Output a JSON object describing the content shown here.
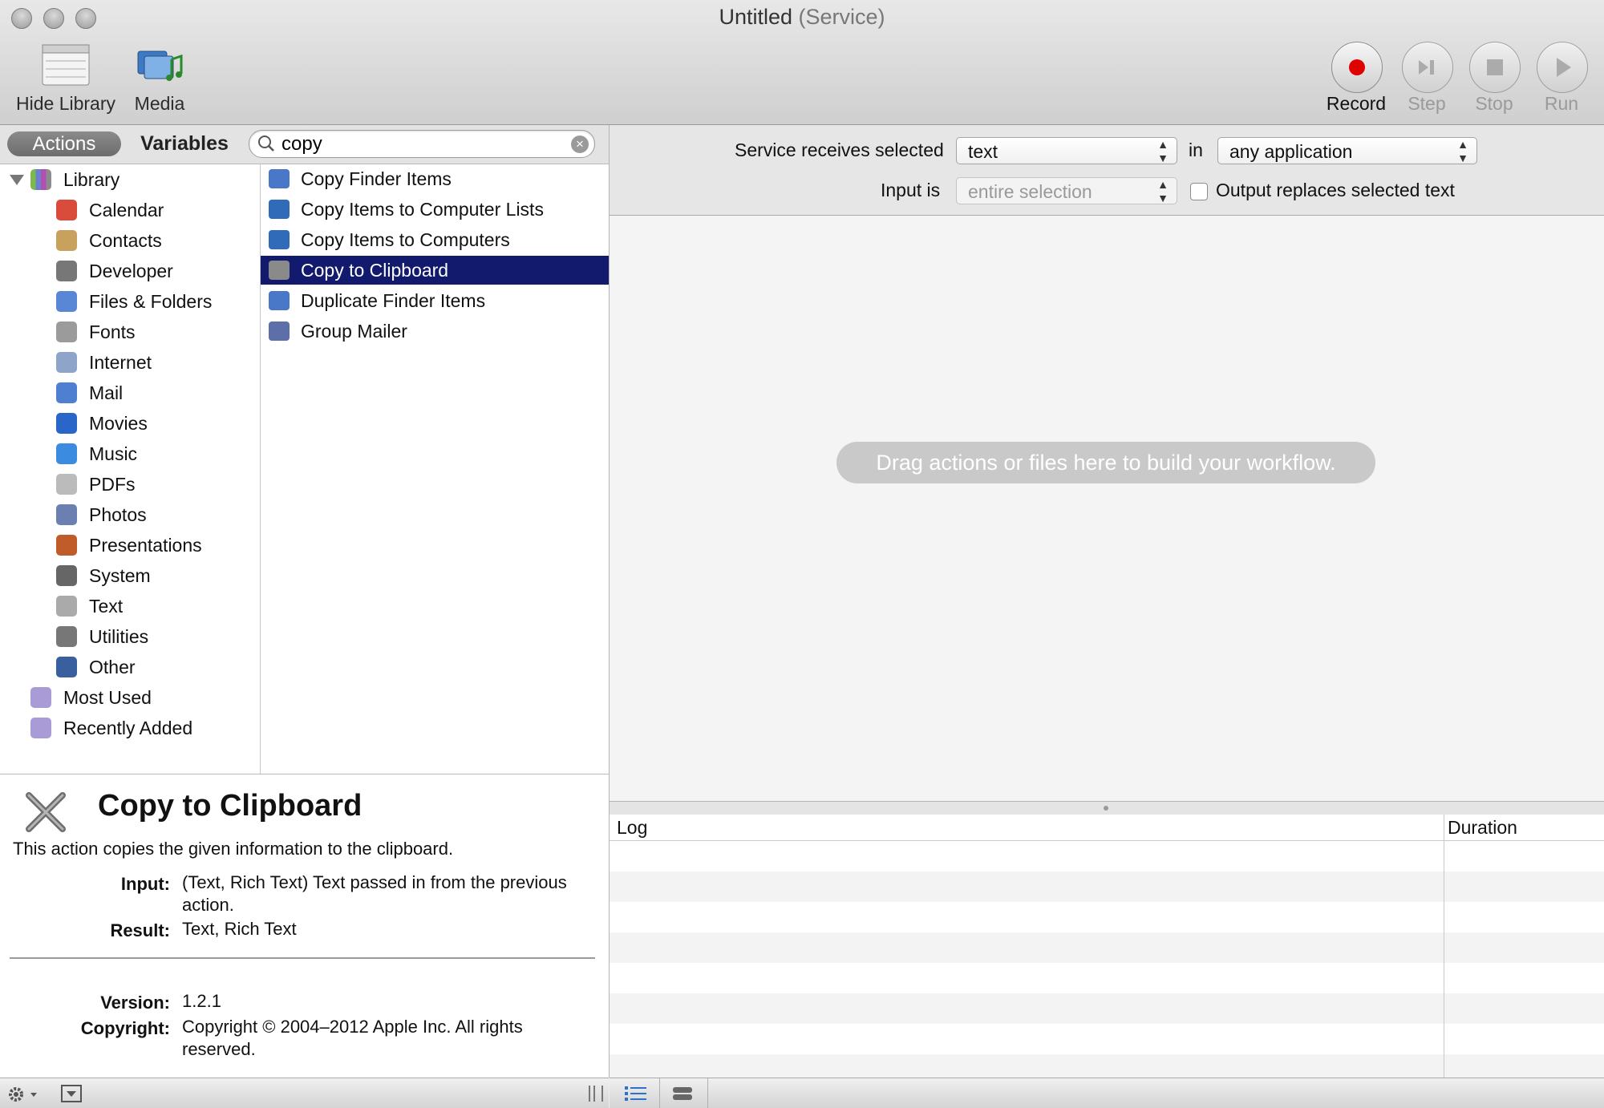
{
  "window": {
    "title": "Untitled",
    "subtitle": "(Service)"
  },
  "toolbar": {
    "hide_library": "Hide Library",
    "media": "Media",
    "record": "Record",
    "step": "Step",
    "stop": "Stop",
    "run": "Run"
  },
  "library_header": {
    "actions_tab": "Actions",
    "variables_tab": "Variables",
    "search_value": "copy"
  },
  "library": {
    "root": "Library",
    "items": [
      "Calendar",
      "Contacts",
      "Developer",
      "Files & Folders",
      "Fonts",
      "Internet",
      "Mail",
      "Movies",
      "Music",
      "PDFs",
      "Photos",
      "Presentations",
      "System",
      "Text",
      "Utilities",
      "Other"
    ],
    "smart": [
      "Most Used",
      "Recently Added"
    ]
  },
  "actions": {
    "items": [
      "Copy Finder Items",
      "Copy Items to Computer Lists",
      "Copy Items to Computers",
      "Copy to Clipboard",
      "Duplicate Finder Items",
      "Group Mailer"
    ],
    "selected": "Copy to Clipboard"
  },
  "description": {
    "title": "Copy to Clipboard",
    "summary": "This action copies the given information to the clipboard.",
    "input_label": "Input:",
    "input_value": "(Text, Rich Text) Text passed in from the previous action.",
    "result_label": "Result:",
    "result_value": "Text, Rich Text",
    "version_label": "Version:",
    "version_value": "1.2.1",
    "copyright_label": "Copyright:",
    "copyright_value": "Copyright © 2004–2012 Apple Inc.  All rights reserved."
  },
  "service": {
    "receives_label": "Service receives selected",
    "receives_value": "text",
    "in_label": "in",
    "app_value": "any application",
    "input_label": "Input is",
    "input_value": "entire selection",
    "output_replaces": "Output replaces selected text",
    "output_replaces_checked": false
  },
  "workflow": {
    "hint": "Drag actions or files here to build your workflow."
  },
  "log": {
    "log_col": "Log",
    "duration_col": "Duration"
  },
  "colors": {
    "selection": "#121a6e",
    "record": "#e00000",
    "hint_bg": "#c9c9c9"
  }
}
